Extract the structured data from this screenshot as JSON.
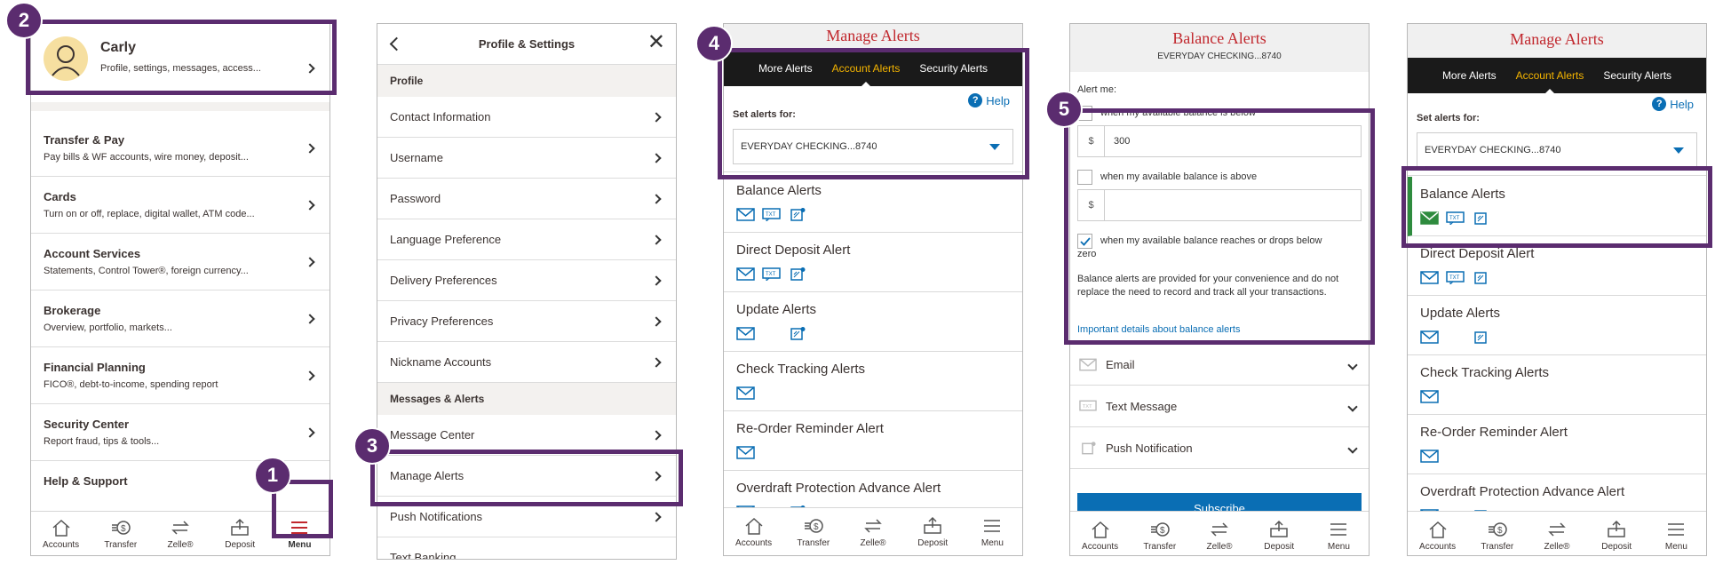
{
  "colors": {
    "brand_red": "#c1272d",
    "accent_yellow": "#f4b400",
    "highlight_purple": "#5b2c6f",
    "link_blue": "#0a6eb4",
    "alert_green": "#2e8b3e"
  },
  "badges": [
    "1",
    "2",
    "3",
    "4",
    "5"
  ],
  "nav": {
    "accounts": "Accounts",
    "transfer": "Transfer",
    "zelle": "Zelle®",
    "deposit": "Deposit",
    "menu": "Menu"
  },
  "screen1": {
    "profile_name": "Carly",
    "profile_sub": "Profile, settings, messages, access...",
    "items": [
      {
        "title": "Transfer & Pay",
        "sub": "Pay bills & WF accounts, wire money, deposit..."
      },
      {
        "title": "Cards",
        "sub": "Turn on or off, replace, digital wallet, ATM code..."
      },
      {
        "title": "Account Services",
        "sub": "Statements, Control Tower®, foreign currency..."
      },
      {
        "title": "Brokerage",
        "sub": "Overview, portfolio, markets..."
      },
      {
        "title": "Financial Planning",
        "sub": "FICO®, debt-to-income,  spending report"
      },
      {
        "title": "Security Center",
        "sub": "Report fraud, tips & tools..."
      },
      {
        "title": "Help & Support",
        "sub": ""
      }
    ]
  },
  "screen2": {
    "title": "Profile & Settings",
    "section_profile": "Profile",
    "profile_items": [
      "Contact Information",
      "Username",
      "Password",
      "Language Preference",
      "Delivery Preferences",
      "Privacy Preferences",
      "Nickname Accounts"
    ],
    "section_messages": "Messages & Alerts",
    "message_items": [
      "Message Center",
      "Manage Alerts",
      "Push Notifications",
      "Text Banking"
    ]
  },
  "alerts": {
    "title": "Manage Alerts",
    "tabs": [
      "More Alerts",
      "Account Alerts",
      "Security Alerts"
    ],
    "help": "Help",
    "set_for": "Set alerts for:",
    "account": "EVERYDAY CHECKING...8740",
    "items": [
      "Balance Alerts",
      "Direct Deposit Alert",
      "Update Alerts",
      "Check Tracking Alerts",
      "Re-Order Reminder Alert",
      "Overdraft Protection Advance Alert"
    ]
  },
  "balance": {
    "title": "Balance Alerts",
    "account": "EVERYDAY CHECKING...8740",
    "alert_me": "Alert me:",
    "below_label": "when my available balance is below",
    "below_value": "300",
    "above_label": "when my available balance is above",
    "currency": "$",
    "zero_label": "when my available balance reaches or drops below",
    "zero_label2": "zero",
    "disclaimer": "Balance alerts are provided for your convenience and do not replace the need to record and track all your transactions.",
    "details_link": "Important details about balance alerts",
    "channels": [
      "Email",
      "Text Message",
      "Push Notification"
    ],
    "subscribe": "Subscribe"
  }
}
